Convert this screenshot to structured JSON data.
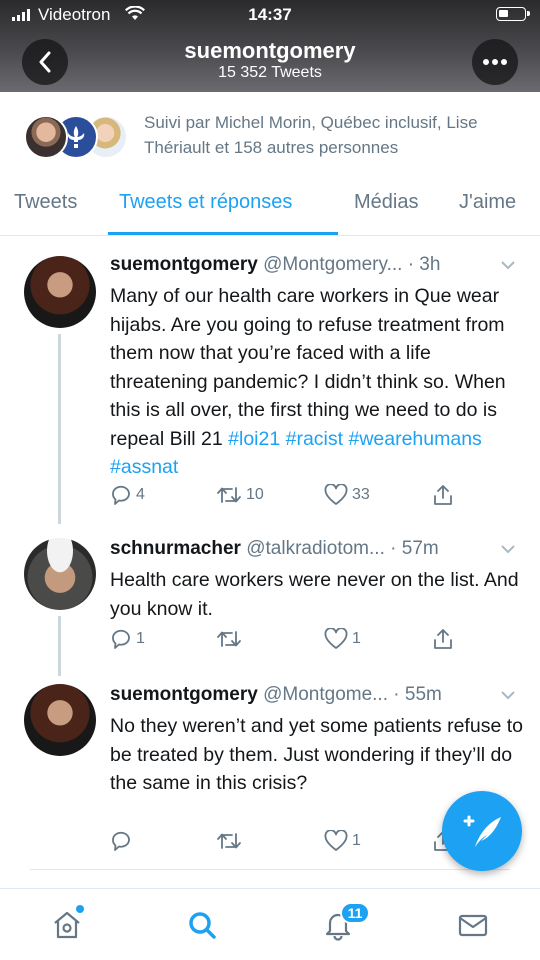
{
  "status_bar": {
    "carrier": "Videotron",
    "time": "14:37"
  },
  "header": {
    "title": "suemontgomery",
    "subtitle": "15 352 Tweets"
  },
  "followers": {
    "text": "Suivi par Michel Morin, Québec inclusif, Lise Thériault et 158 autres personnes"
  },
  "tabs": [
    {
      "label": "Tweets"
    },
    {
      "label": "Tweets et réponses",
      "active": true
    },
    {
      "label": "Médias"
    },
    {
      "label": "J'aime"
    }
  ],
  "tweets": [
    {
      "name": "suemontgomery",
      "handle": "@Montgomery...",
      "time": "· 3h",
      "text": "Many of our health care workers in Que wear hijabs. Are you going to refuse treatment from them now that you’re faced with a life threatening pandemic? I didn’t think so. When this is all over, the first thing we need to do is repeal Bill 21",
      "hashtags": "#loi21 #racist #wearehumans #assnat",
      "replies": "4",
      "retweets": "10",
      "likes": "33"
    },
    {
      "name": "schnurmacher",
      "handle": "@talkradiotom...",
      "time": "· 57m",
      "text": "Health care workers were never on the list. And you know it.",
      "replies": "1",
      "retweets": "",
      "likes": "1"
    },
    {
      "name": "suemontgomery",
      "handle": "@Montgome...",
      "time": "· 55m",
      "text": "No they weren’t and yet some patients refuse to be treated by them. Just wondering if they’ll do the same in this crisis?",
      "replies": "",
      "retweets": "",
      "likes": "1"
    }
  ],
  "bottom_nav": {
    "items": [
      "home-icon",
      "search-icon",
      "notifications-icon",
      "messages-icon"
    ],
    "notification_count": "11"
  },
  "colors": {
    "accent": "#1da1f2",
    "text": "#14171a",
    "muted": "#657786",
    "border": "#e1e8ed"
  }
}
